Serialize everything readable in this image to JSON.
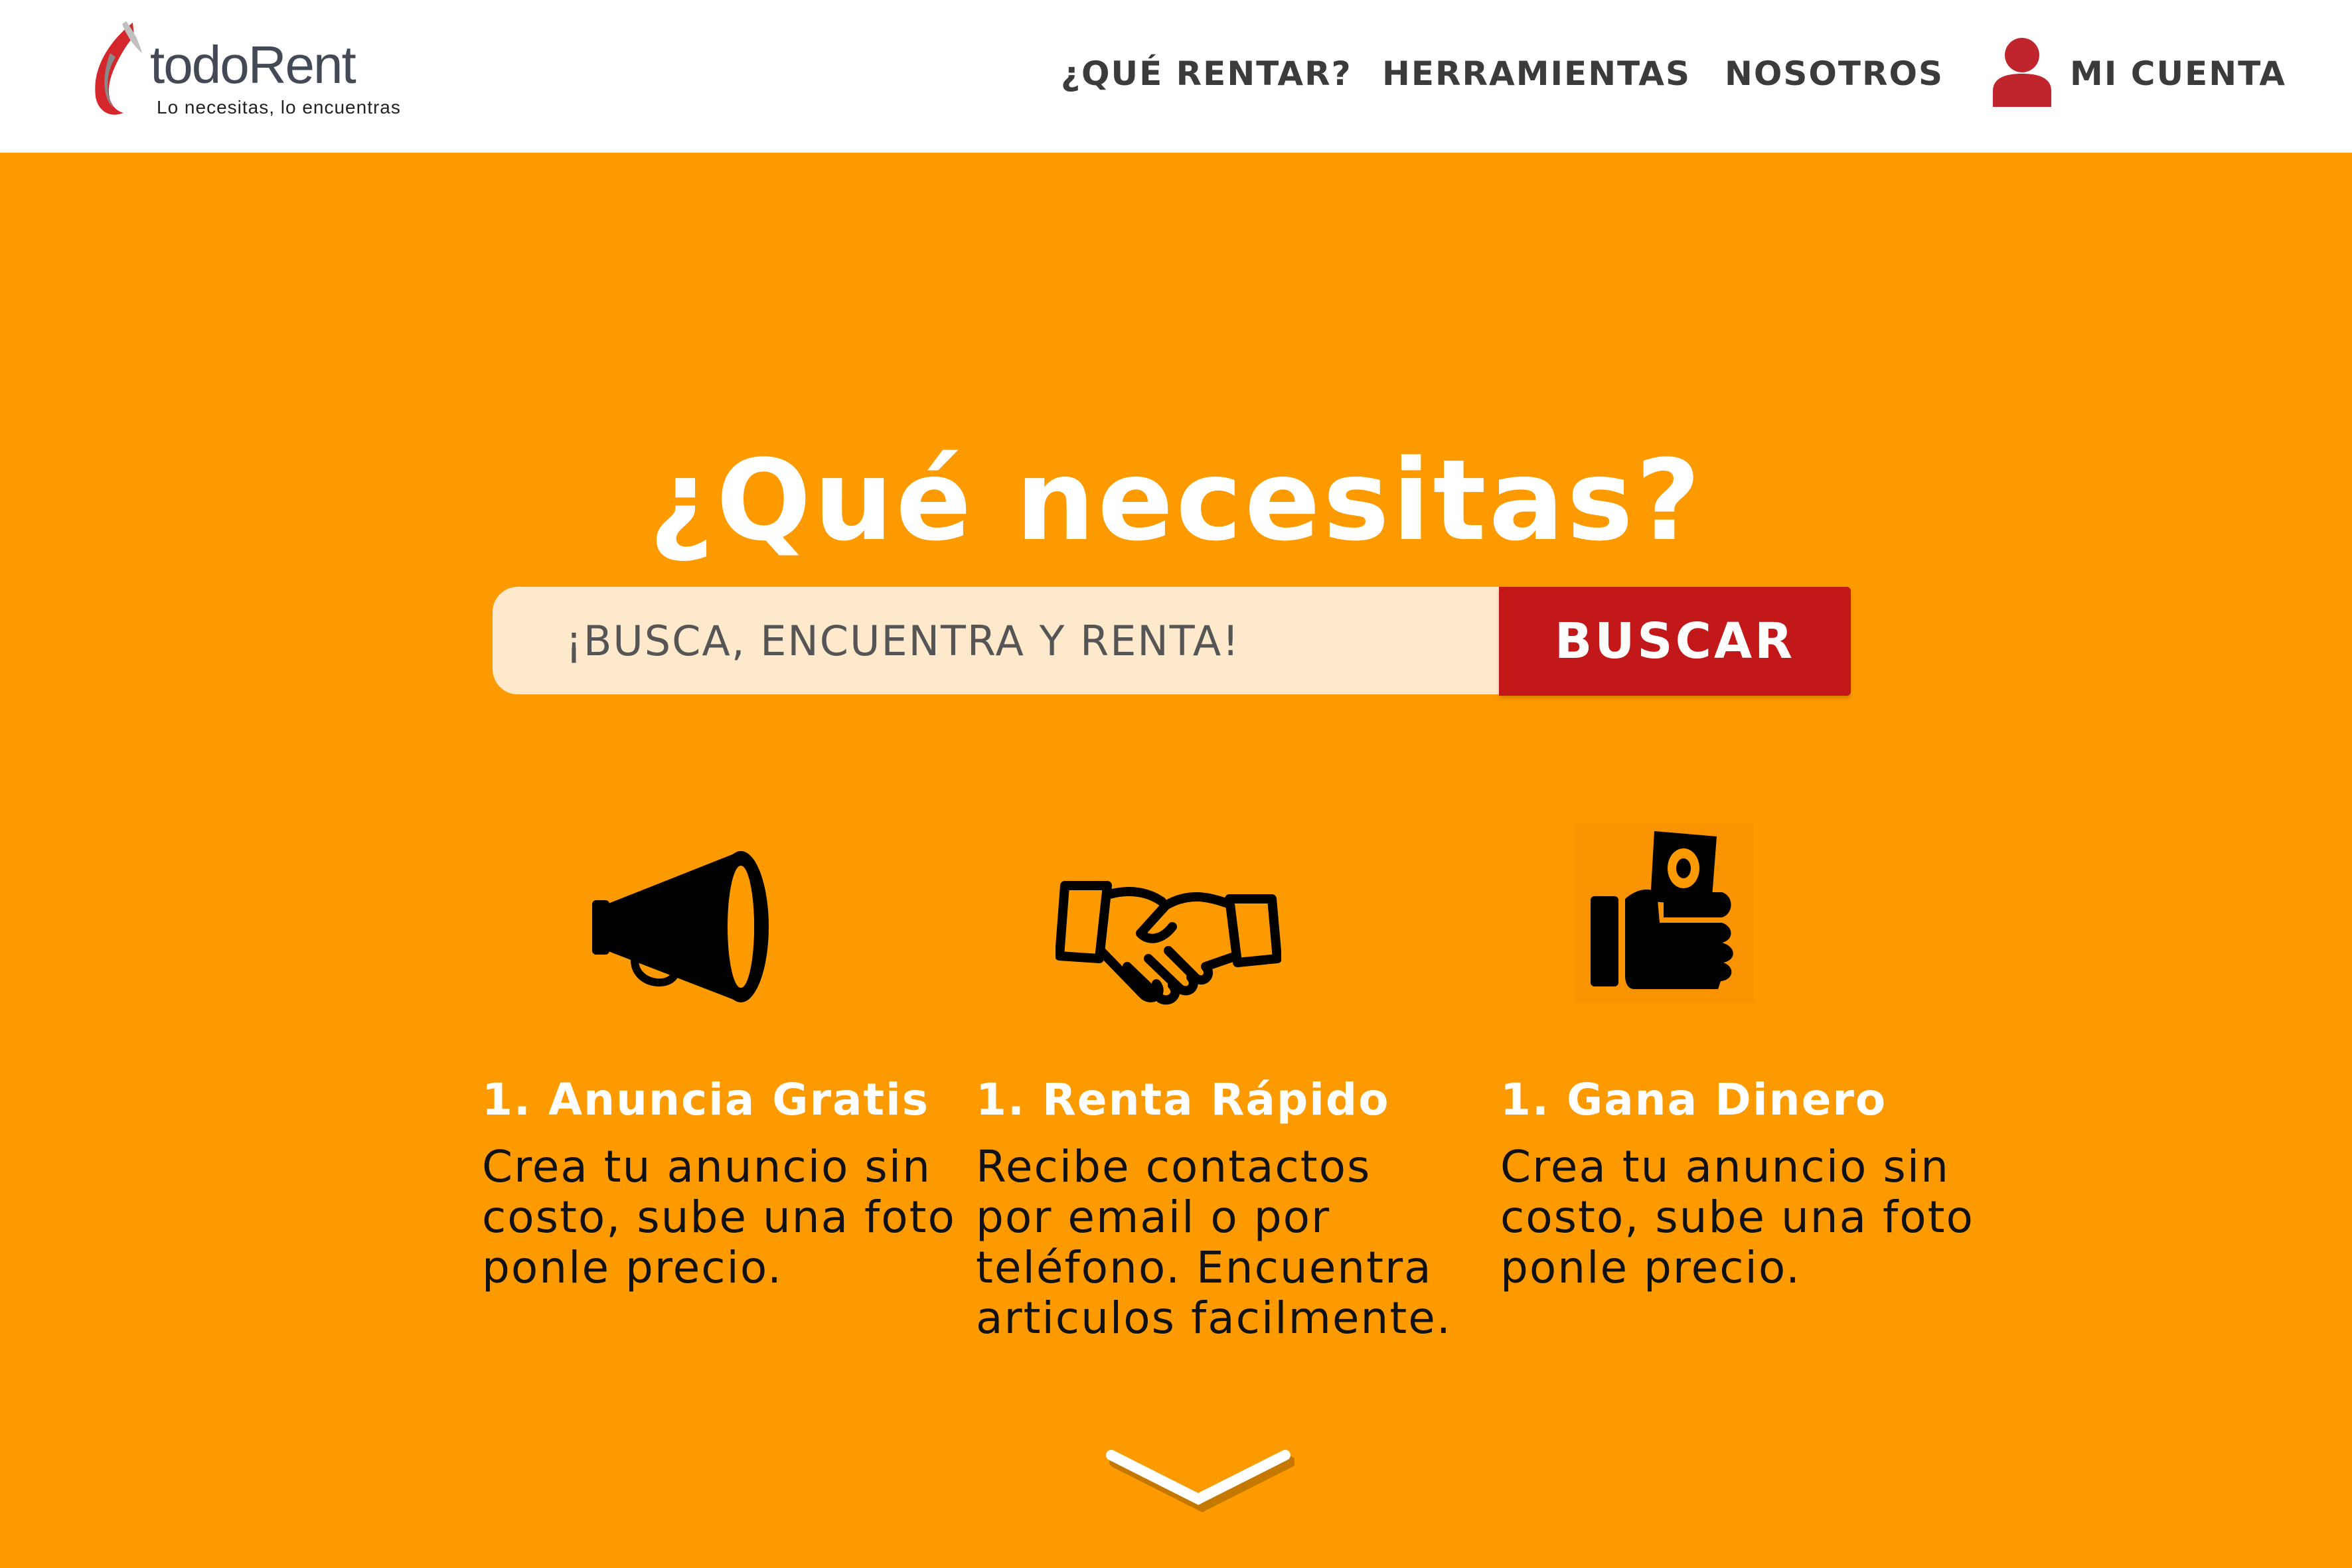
{
  "brand": {
    "name": "todoRent",
    "tagline": "Lo necesitas, lo encuentras"
  },
  "nav": {
    "items": [
      {
        "label": "¿QUÉ RENTAR?"
      },
      {
        "label": "HERRAMIENTAS"
      },
      {
        "label": "NOSOTROS"
      },
      {
        "label": "MI CUENTA"
      }
    ]
  },
  "hero": {
    "title": "¿Qué necesitas?",
    "search_placeholder": "¡BUSCA, ENCUENTRA Y RENTA!",
    "search_button": "BUSCAR"
  },
  "features": [
    {
      "icon": "megaphone-icon",
      "title": "1. Anuncia Gratis",
      "description": "Crea tu anuncio sin costo, sube una foto ponle precio."
    },
    {
      "icon": "handshake-icon",
      "title": "1. Renta Rápido",
      "description": "Recibe contactos por email o por teléfono. Encuentra articulos facilmente."
    },
    {
      "icon": "hand-money-icon",
      "title": "1. Gana Dinero",
      "description": "Crea tu anuncio sin costo, sube una foto ponle precio."
    }
  ],
  "icons": {
    "logo": "todorent-logo-icon",
    "account": "user-icon",
    "scroll": "chevron-down-icon"
  },
  "colors": {
    "background": "#fd9a00",
    "header": "#ffffff",
    "search_field": "#ffe9cc",
    "button": "#c2181a",
    "accent_red": "#c0252d"
  }
}
